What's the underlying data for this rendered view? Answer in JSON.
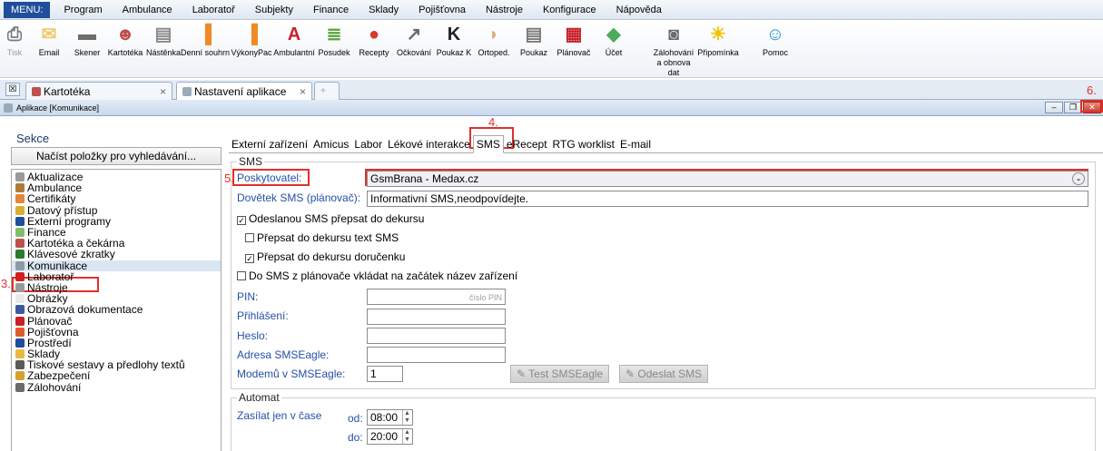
{
  "menu": {
    "label": "MENU:",
    "items": [
      "Program",
      "Ambulance",
      "Laboratoř",
      "Subjekty",
      "Finance",
      "Sklady",
      "Pojišťovna",
      "Nástroje",
      "Konfigurace",
      "Nápověda"
    ]
  },
  "toolbar": [
    {
      "label": "Tisk",
      "icon": "printer-icon",
      "color": "#7a7a7a"
    },
    {
      "label": "Email",
      "icon": "envelope-icon",
      "color": "#f2c66a"
    },
    {
      "label": "Skener",
      "icon": "scanner-icon",
      "color": "#6d6d6d"
    },
    {
      "label": "Kartotéka",
      "icon": "people-icon",
      "color": "#c0504d"
    },
    {
      "label": "Nástěnka",
      "icon": "board-icon",
      "color": "#8a8a8a"
    },
    {
      "label": "Denní souhrn",
      "icon": "bar-chart-icon",
      "color": "#f08a24"
    },
    {
      "label": "VýkonyPac",
      "icon": "bar-chart-icon",
      "color": "#f08a24"
    },
    {
      "label": "Ambulantní",
      "icon": "letter-a-icon",
      "color": "#c8202a"
    },
    {
      "label": "Posudek",
      "icon": "document-icon",
      "color": "#5aa33a"
    },
    {
      "label": "Recepty",
      "icon": "pills-icon",
      "color": "#d63a2e"
    },
    {
      "label": "Očkování",
      "icon": "syringe-icon",
      "color": "#6b6b6b"
    },
    {
      "label": "Poukaz K",
      "icon": "letter-k-icon",
      "color": "#222222"
    },
    {
      "label": "Ortoped.",
      "icon": "ortho-icon",
      "color": "#d8b278"
    },
    {
      "label": "Poukaz",
      "icon": "form-icon",
      "color": "#7a7a7a"
    },
    {
      "label": "Plánovač",
      "icon": "calendar-icon",
      "color": "#c8202a"
    },
    {
      "label": "Účet",
      "icon": "money-icon",
      "color": "#4caa5a"
    },
    {
      "label": "Zálohování a obnova dat",
      "icon": "backup-icon",
      "color": "#6b6b6b"
    },
    {
      "label": "Připomínka",
      "icon": "bulb-icon",
      "color": "#f2c200"
    },
    {
      "label": "Pomoc",
      "icon": "help-icon",
      "color": "#1d8fd6"
    }
  ],
  "doc_tabs": [
    {
      "label": "Kartotéka"
    },
    {
      "label": "Nastavení aplikace"
    }
  ],
  "window_title": "Aplikace [Komunikace]",
  "annotations": {
    "a3": "3.",
    "a4": "4.",
    "a5": "5.",
    "a6": "6."
  },
  "sekce": {
    "title": "Sekce",
    "load_button": "Načíst položky pro vyhledávání...",
    "items": [
      {
        "label": "Aktualizace",
        "color": "#9a9a9a"
      },
      {
        "label": "Ambulance",
        "color": "#b07a3a"
      },
      {
        "label": "Certifikáty",
        "color": "#e0883a"
      },
      {
        "label": "Datový přístup",
        "color": "#d8b030"
      },
      {
        "label": "Externí programy",
        "color": "#1f4e9b"
      },
      {
        "label": "Finance",
        "color": "#7fbf6a"
      },
      {
        "label": "Kartotéka a čekárna",
        "color": "#c0504d"
      },
      {
        "label": "Klávesové zkratky",
        "color": "#2e7a2e"
      },
      {
        "label": "Komunikace",
        "color": "#8a9aa8"
      },
      {
        "label": "Laboratoř",
        "color": "#d02020"
      },
      {
        "label": "Nástroje",
        "color": "#9a9a9a"
      },
      {
        "label": "Obrázky",
        "color": "#e8e8e8"
      },
      {
        "label": "Obrazová dokumentace",
        "color": "#3a5a9a"
      },
      {
        "label": "Plánovač",
        "color": "#c8202a"
      },
      {
        "label": "Pojišťovna",
        "color": "#e05a2a"
      },
      {
        "label": "Prostředí",
        "color": "#1f4e9b"
      },
      {
        "label": "Sklady",
        "color": "#e8b840"
      },
      {
        "label": "Tiskové sestavy a předlohy textů",
        "color": "#5a5a5a"
      },
      {
        "label": "Zabezpečení",
        "color": "#d8a030"
      },
      {
        "label": "Zálohování",
        "color": "#6a6a6a"
      }
    ]
  },
  "panel_tabs": [
    "Externí zařízení",
    "Amicus",
    "Labor",
    "Lékové interakce",
    "SMS",
    "eRecept",
    "RTG worklist",
    "E-mail"
  ],
  "sms": {
    "group_title": "SMS",
    "provider_label": "Poskytovatel:",
    "provider_value": "GsmBrana - Medax.cz",
    "dovetek_label": "Dovětek SMS (plánovač):",
    "dovetek_value": "Informativní SMS,neodpovídejte.",
    "cb1": "Odeslanou SMS přepsat do dekursu",
    "cb2": "Přepsat do dekursu text SMS",
    "cb3": "Přepsat do dekursu doručenku",
    "cb4": "Do SMS z plánovače vkládat na začátek název zařízení",
    "pin_label": "PIN:",
    "pin_placeholder": "číslo PIN",
    "login_label": "Přihlášení:",
    "password_label": "Heslo:",
    "address_label": "Adresa SMSEagle:",
    "modems_label": "Modemů v SMSEagle:",
    "modems_value": "1",
    "test_button": "Test SMSEagle",
    "send_button": "Odeslat SMS"
  },
  "automat": {
    "group_title": "Automat",
    "label": "Zasílat jen v čase",
    "from_label": "od:",
    "from_value": "08:00",
    "to_label": "do:",
    "to_value": "20:00"
  }
}
